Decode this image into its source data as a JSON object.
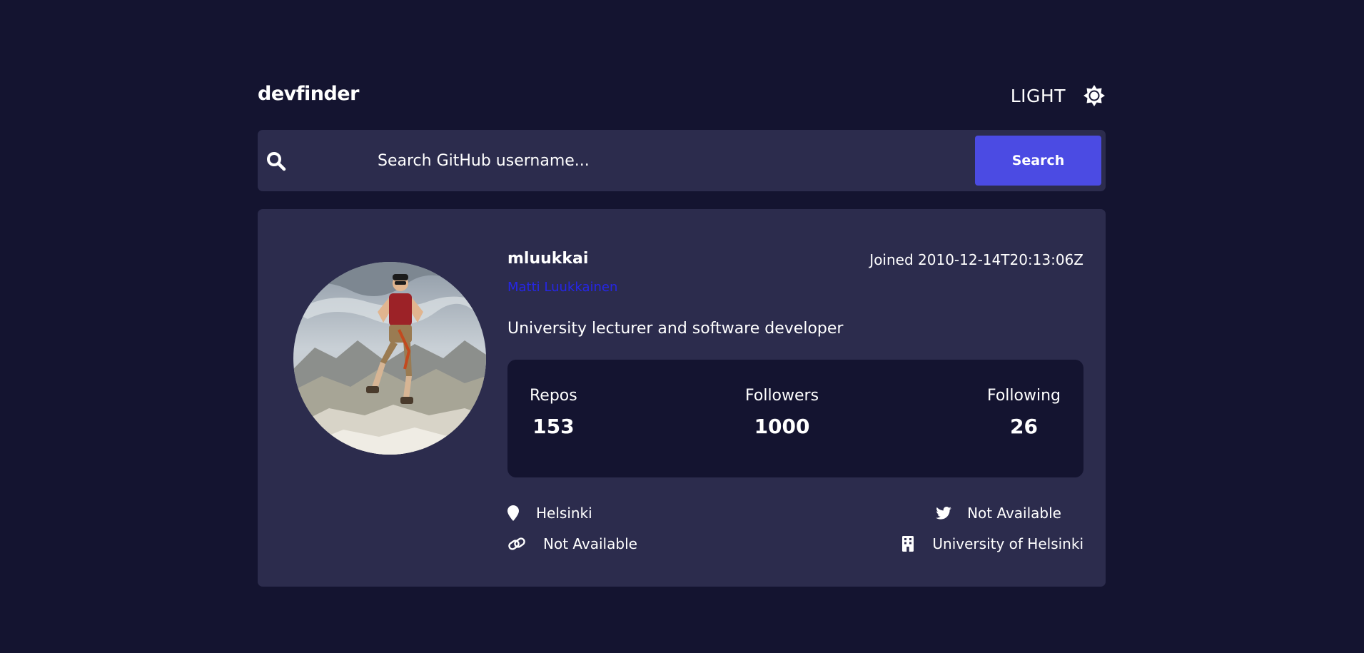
{
  "header": {
    "logo": "devfinder",
    "theme_toggle_label": "LIGHT",
    "theme_icon": "sun-icon"
  },
  "search": {
    "icon": "search-icon",
    "placeholder": "Search GitHub username...",
    "value": "",
    "button_label": "Search"
  },
  "profile": {
    "avatar_alt": "mluukkai",
    "login": "mluukkai",
    "name": "Matti Luukkainen",
    "joined": "Joined 2010-12-14T20:13:06Z",
    "bio": "University lecturer and software developer",
    "stats": {
      "repos_label": "Repos",
      "repos_value": "153",
      "followers_label": "Followers",
      "followers_value": "1000",
      "following_label": "Following",
      "following_value": "26"
    },
    "links": {
      "location": "Helsinki",
      "location_icon": "location-pin-icon",
      "blog": "Not Available",
      "blog_icon": "link-icon",
      "twitter": "Not Available",
      "twitter_icon": "twitter-icon",
      "company": "University of Helsinki",
      "company_icon": "building-icon"
    }
  },
  "colors": {
    "background": "#141430",
    "card": "#2c2c4d",
    "accent": "#4b4be3",
    "name_link": "#2626e6",
    "text": "#ffffff"
  }
}
